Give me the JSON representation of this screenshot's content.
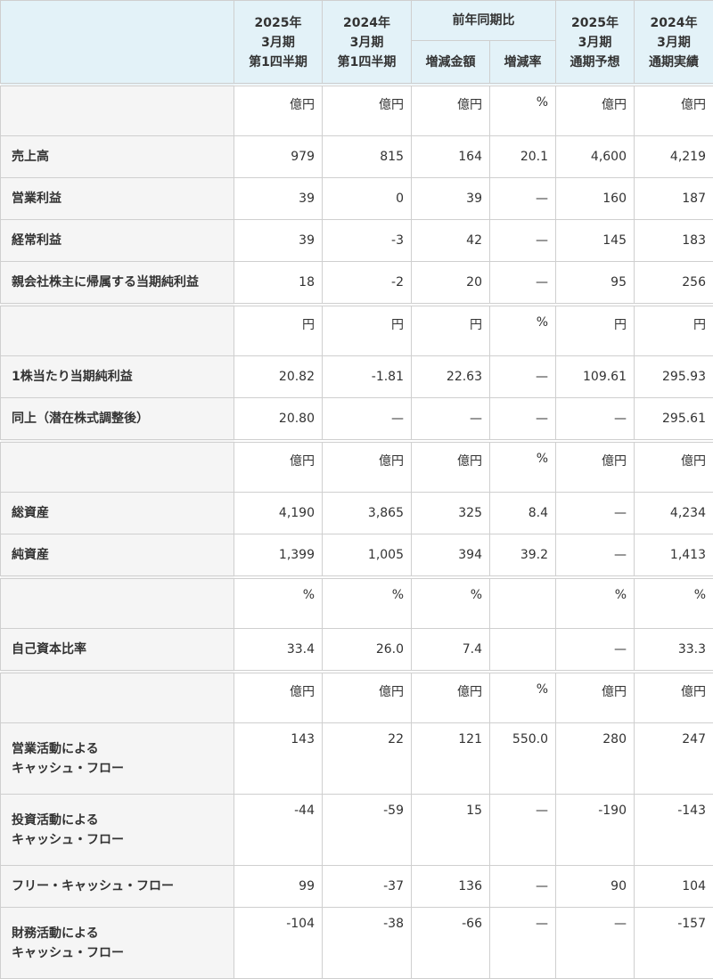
{
  "header": {
    "col1": [
      "2025年",
      "3月期",
      "第1四半期"
    ],
    "col2": [
      "2024年",
      "3月期",
      "第1四半期"
    ],
    "group": "前年同期比",
    "col3": "増減金額",
    "col4": "増減率",
    "col5": [
      "2025年",
      "3月期",
      "通期予想"
    ],
    "col6": [
      "2024年",
      "3月期",
      "通期実績"
    ]
  },
  "sections": [
    {
      "units": [
        "億円",
        "億円",
        "億円",
        "%",
        "億円",
        "億円"
      ],
      "rows": [
        {
          "label": "売上高",
          "values": [
            "979",
            "815",
            "164",
            "20.1",
            "4,600",
            "4,219"
          ]
        },
        {
          "label": "営業利益",
          "values": [
            "39",
            "0",
            "39",
            "—",
            "160",
            "187"
          ]
        },
        {
          "label": "経常利益",
          "values": [
            "39",
            "-3",
            "42",
            "—",
            "145",
            "183"
          ]
        },
        {
          "label": "親会社株主に帰属する当期純利益",
          "values": [
            "18",
            "-2",
            "20",
            "—",
            "95",
            "256"
          ]
        }
      ]
    },
    {
      "units": [
        "円",
        "円",
        "円",
        "%",
        "円",
        "円"
      ],
      "rows": [
        {
          "label": "1株当たり当期純利益",
          "values": [
            "20.82",
            "-1.81",
            "22.63",
            "—",
            "109.61",
            "295.93"
          ]
        },
        {
          "label": "同上（潜在株式調整後）",
          "values": [
            "20.80",
            "—",
            "—",
            "—",
            "—",
            "295.61"
          ]
        }
      ]
    },
    {
      "units": [
        "億円",
        "億円",
        "億円",
        "%",
        "億円",
        "億円"
      ],
      "rows": [
        {
          "label": "総資産",
          "values": [
            "4,190",
            "3,865",
            "325",
            "8.4",
            "—",
            "4,234"
          ]
        },
        {
          "label": "純資産",
          "values": [
            "1,399",
            "1,005",
            "394",
            "39.2",
            "—",
            "1,413"
          ]
        }
      ]
    },
    {
      "units": [
        "%",
        "%",
        "%",
        "",
        "%",
        "%"
      ],
      "rows": [
        {
          "label": "自己資本比率",
          "values": [
            "33.4",
            "26.0",
            "7.4",
            "",
            "—",
            "33.3"
          ]
        }
      ]
    },
    {
      "units": [
        "億円",
        "億円",
        "億円",
        "%",
        "億円",
        "億円"
      ],
      "rows": [
        {
          "label": [
            "営業活動による",
            "キャッシュ・フロー"
          ],
          "values": [
            "143",
            "22",
            "121",
            "550.0",
            "280",
            "247"
          ]
        },
        {
          "label": [
            "投資活動による",
            "キャッシュ・フロー"
          ],
          "values": [
            "-44",
            "-59",
            "15",
            "—",
            "-190",
            "-143"
          ]
        },
        {
          "label": "フリー・キャッシュ・フロー",
          "values": [
            "99",
            "-37",
            "136",
            "—",
            "90",
            "104"
          ]
        },
        {
          "label": [
            "財務活動による",
            "キャッシュ・フロー"
          ],
          "values": [
            "-104",
            "-38",
            "-66",
            "—",
            "—",
            "-157"
          ]
        }
      ]
    }
  ]
}
